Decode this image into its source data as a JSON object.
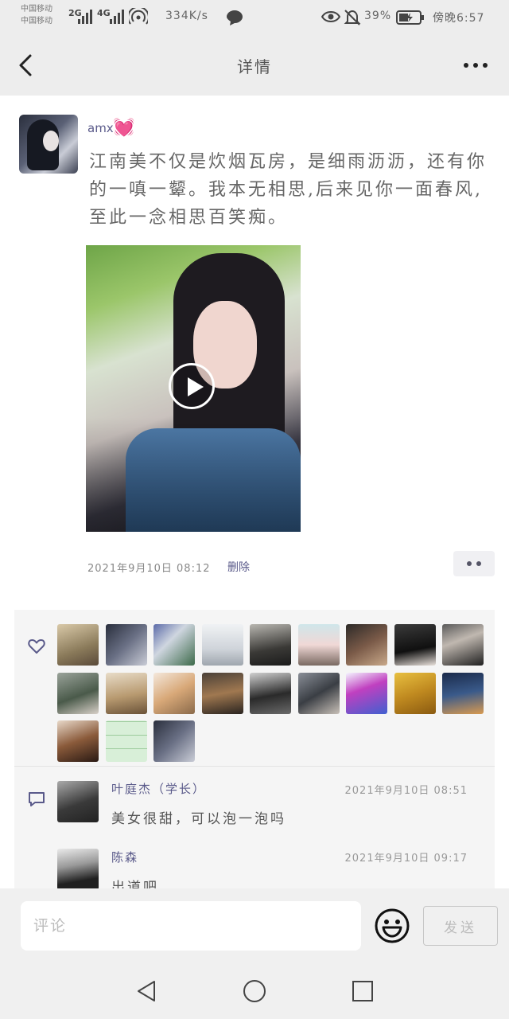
{
  "status_bar": {
    "carrier_1": "中国移动",
    "carrier_2": "中国移动",
    "network_1": "2G",
    "network_2": "4G",
    "speed": "334K/s",
    "battery": "39%",
    "time": "傍晚6:57"
  },
  "nav": {
    "title": "详情",
    "back_icon": "chevron-left-icon",
    "more_icon": "more-horizontal-icon"
  },
  "post": {
    "author": "amx",
    "author_emoji": "💓",
    "text": "江南美不仅是炊烟瓦房，是细雨沥沥，还有你的一嗔一颦。我本无相思,后来见你一面春风,至此一念相思百笑痴。",
    "media": "video",
    "time": "2021年9月10日 08:12",
    "delete_label": "删除"
  },
  "likes": {
    "icon": "heart-outline-icon",
    "count": 21
  },
  "comments": {
    "icon": "comment-icon",
    "items": [
      {
        "author": "叶庭杰（学长）",
        "time": "2021年9月10日 08:51",
        "text": "美女很甜，可以泡一泡吗"
      },
      {
        "author": "陈森",
        "time": "2021年9月10日 09:17",
        "text": "出道吧"
      }
    ]
  },
  "input_bar": {
    "placeholder": "评论",
    "emoji_icon": "smiley-icon",
    "send_label": "发送"
  },
  "system_nav": {
    "back_icon": "triangle-back-icon",
    "home_icon": "circle-home-icon",
    "recents_icon": "square-recents-icon"
  },
  "colors": {
    "link_purple": "#5a5a8a",
    "heart_pink": "#ff4fa3",
    "header_bg": "#ededed",
    "panel_bg": "#f5f5f5"
  }
}
